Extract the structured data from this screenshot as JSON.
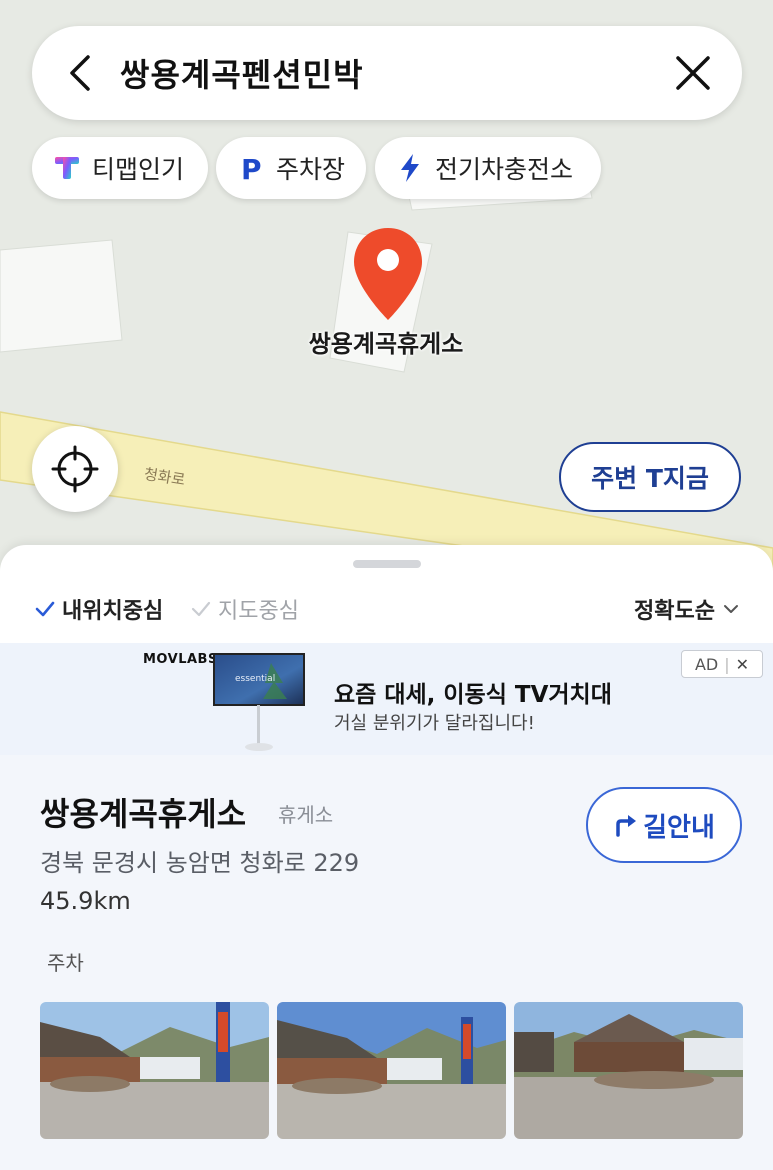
{
  "search": {
    "query": "쌍용계곡펜션민박"
  },
  "chips": [
    {
      "label": "티맵인기",
      "icon": "tmap-logo-icon"
    },
    {
      "label": "주차장",
      "icon": "parking-icon"
    },
    {
      "label": "전기차충전소",
      "icon": "lightning-icon"
    }
  ],
  "map": {
    "poi_label": "쌍용계곡휴게소",
    "road_label": "청화로",
    "nearby_button": "주변 T지금"
  },
  "filters": {
    "my_location": "내위치중심",
    "map_center": "지도중심",
    "sort": "정확도순"
  },
  "ad": {
    "brand": "MOVLABS",
    "tv_screen_text": "essential",
    "title": "요즘 대세, 이동식 TV거치대",
    "subtitle": "거실 분위기가 달라집니다!",
    "badge": "AD",
    "badge_close": "✕"
  },
  "result": {
    "name": "쌍용계곡휴게소",
    "category": "휴게소",
    "address": "경북 문경시 농암면 청화로 229",
    "distance": "45.9km",
    "tag": "주차",
    "route_button": "길안내",
    "photo_count": 3
  },
  "colors": {
    "accent": "#1e4bbf",
    "pin": "#ee4b2b",
    "map_bg": "#e7eae4",
    "road": "#f6efb8"
  }
}
